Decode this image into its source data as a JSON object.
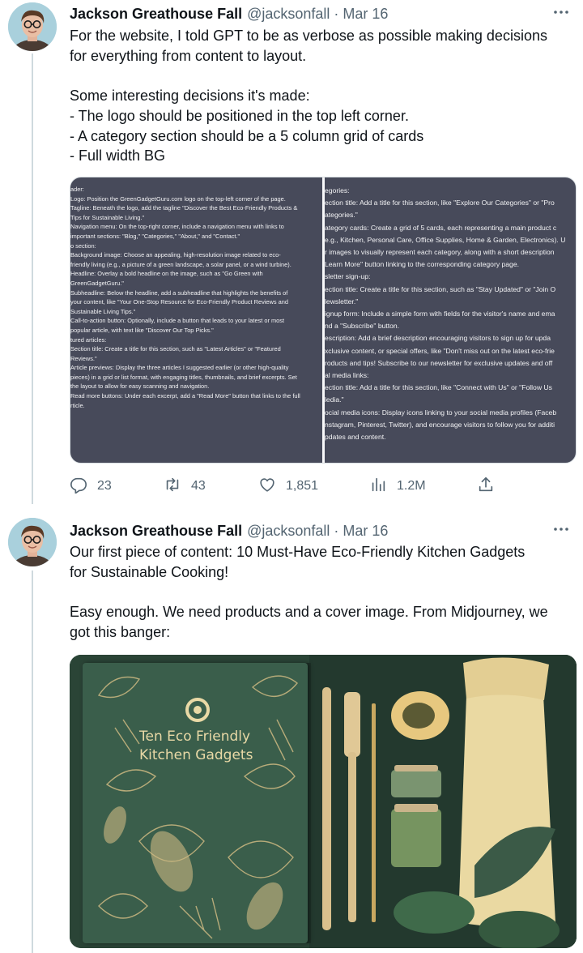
{
  "tweets": [
    {
      "author": "Jackson Greathouse Fall",
      "handle": "@jacksonfall",
      "separator": "·",
      "date": "Mar 16",
      "text_lines": [
        "For the website, I told GPT to be as verbose as possible making decisions",
        "for everything from content to layout.",
        "",
        "Some interesting decisions it's made:",
        "- The logo should be positioned in the top left corner.",
        "- A category section should be a 5 column grid of cards",
        "- Full width BG"
      ],
      "media_left_lines": [
        "ader:",
        "Logo: Position the GreenGadgetGuru.com logo on the top-left corner of the page.",
        "Tagline: Beneath the logo, add the tagline \"Discover the Best Eco-Friendly Products &",
        "Tips for Sustainable Living.\"",
        "Navigation menu: On the top-right corner, include a navigation menu with links to",
        "important sections: \"Blog,\" \"Categories,\" \"About,\" and \"Contact.\"",
        "o section:",
        "Background image: Choose an appealing, high-resolution image related to eco-",
        "friendly living (e.g., a picture of a green landscape, a solar panel, or a wind turbine).",
        "Headline: Overlay a bold headline on the image, such as \"Go Green with",
        "GreenGadgetGuru.\"",
        "Subheadline: Below the headline, add a subheadline that highlights the benefits of",
        "your content, like \"Your One-Stop Resource for Eco-Friendly Product Reviews and",
        "Sustainable Living Tips.\"",
        "Call-to-action button: Optionally, include a button that leads to your latest or most",
        "popular article, with text like \"Discover Our Top Picks.\"",
        "tured articles:",
        "Section title: Create a title for this section, such as \"Latest Articles\" or \"Featured",
        "Reviews.\"",
        "Article previews: Display the three articles I suggested earlier (or other high-quality",
        "pieces) in a grid or list format, with engaging titles, thumbnails, and brief excerpts. Set",
        "the layout to allow for easy scanning and navigation.",
        "Read more buttons: Under each excerpt, add a \"Read More\" button that links to the full",
        "rticle."
      ],
      "media_right_lines": [
        "egories:",
        "ection title: Add a title for this section, like \"Explore Our Categories\" or \"Pro",
        "ategories.\"",
        "ategory cards: Create a grid of 5 cards, each representing a main product c",
        "e.g., Kitchen, Personal Care, Office Supplies, Home & Garden, Electronics). U",
        "r images to visually represent each category, along with a short description",
        "Learn More\" button linking to the corresponding category page.",
        "sletter sign-up:",
        "ection title: Create a title for this section, such as \"Stay Updated\" or \"Join O",
        "lewsletter.\"",
        "ignup form: Include a simple form with fields for the visitor's name and ema",
        "nd a \"Subscribe\" button.",
        "escription: Add a brief description encouraging visitors to sign up for upda",
        "xclusive content, or special offers, like \"Don't miss out on the latest eco-frie",
        "roducts and tips! Subscribe to our newsletter for exclusive updates and off",
        "al media links:",
        "ection title: Add a title for this section, like \"Connect with Us\" or \"Follow Us",
        "ledia.\"",
        "ocial media icons: Display icons linking to your social media profiles (Faceb",
        "nstagram, Pinterest, Twitter), and encourage visitors to follow you for additi",
        "pdates and content."
      ],
      "stats": {
        "replies": "23",
        "retweets": "43",
        "likes": "1,851",
        "views": "1.2M"
      }
    },
    {
      "author": "Jackson Greathouse Fall",
      "handle": "@jacksonfall",
      "separator": "·",
      "date": "Mar 16",
      "text_lines": [
        "Our first piece of content: 10 Must-Have Eco-Friendly Kitchen Gadgets",
        "for Sustainable Cooking!",
        "",
        "Easy enough. We need products and a cover image. From Midjourney, we",
        "got this banger:"
      ],
      "media_cover_title_lines": [
        "Ten Eco Friendly",
        "Kitchen Gadgets"
      ]
    }
  ],
  "colors": {
    "text_primary": "#0f1419",
    "text_secondary": "#536471",
    "thread_line": "#cfd9de",
    "screenshot_bg": "#474a5a",
    "cover_green": "#3a5e4b",
    "cover_gold": "#e9d9a6"
  },
  "icons": {
    "reply": "reply-icon",
    "retweet": "retweet-icon",
    "like": "heart-icon",
    "views": "views-chart-icon",
    "share": "share-icon",
    "more": "more-dots-icon"
  }
}
